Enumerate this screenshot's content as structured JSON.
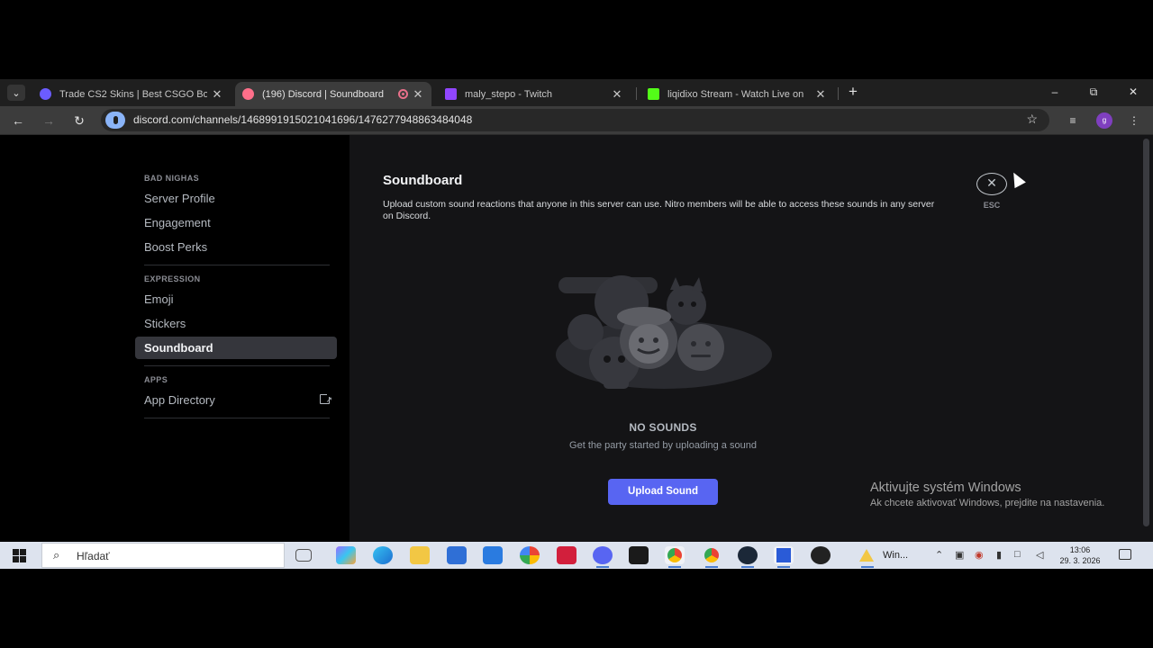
{
  "browser": {
    "tabs": [
      {
        "title": "Trade CS2 Skins | Best CSGO Bo",
        "favicon_color": "#6b5cff",
        "active": false
      },
      {
        "title": "(196) Discord | Soundboard",
        "favicon_color": "#ff6f8a",
        "active": true
      },
      {
        "title": "maly_stepo - Twitch",
        "favicon_color": "#9146ff",
        "active": false
      },
      {
        "title": "liqidixo Stream - Watch Live on",
        "favicon_color": "#53fc18",
        "active": false
      }
    ],
    "url": "discord.com/channels/1468991915021041696/1476277948863484048",
    "profile_initial": "g"
  },
  "sidebar": {
    "server_header": "BAD NIGHAS",
    "server_items": [
      "Server Profile",
      "Engagement",
      "Boost Perks"
    ],
    "expression_header": "EXPRESSION",
    "expression_items": [
      "Emoji",
      "Stickers",
      "Soundboard"
    ],
    "apps_header": "APPS",
    "apps_items": [
      "App Directory"
    ]
  },
  "main": {
    "title": "Soundboard",
    "description": "Upload custom sound reactions that anyone in this server can use. Nitro members will be able to access these sounds in any server on Discord.",
    "esc_label": "ESC",
    "empty_title": "NO SOUNDS",
    "empty_subtitle": "Get the party started by uploading a sound",
    "upload_button": "Upload Sound"
  },
  "watermark": {
    "title": "Aktivujte systém Windows",
    "subtitle": "Ak chcete aktivovať Windows, prejdite na nastavenia."
  },
  "taskbar": {
    "search_placeholder": "Hľadať",
    "window_label": "Win...",
    "time": "13:06",
    "date": "29. 3. 2026"
  },
  "colors": {
    "accent": "#5865f2",
    "selected_item": "#35363c",
    "content_bg": "#141416"
  }
}
